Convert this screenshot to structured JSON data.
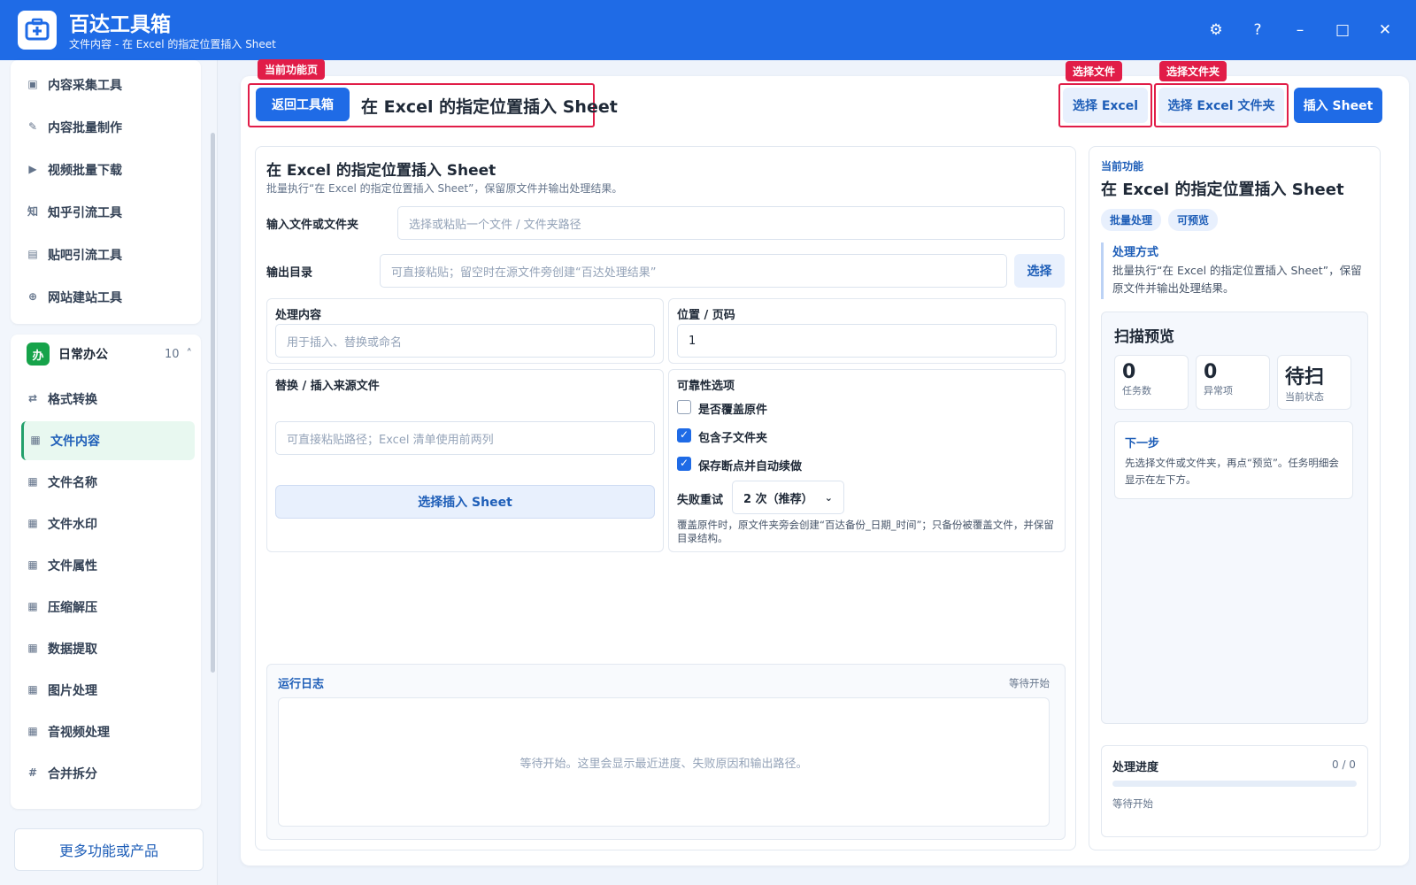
{
  "app": {
    "title": "百达工具箱",
    "subtitle": "文件内容 - 在 Excel 的指定位置插入 Sheet"
  },
  "window_controls": {
    "settings": "⚙",
    "help": "?",
    "minimize": "–",
    "maximize": "□",
    "close": "✕"
  },
  "sidebar": {
    "tools_items": [
      {
        "icon": "▣",
        "label": "内容采集工具"
      },
      {
        "icon": "✎",
        "label": "内容批量制作"
      },
      {
        "icon": "▶",
        "label": "视频批量下载"
      },
      {
        "icon": "知",
        "label": "知乎引流工具"
      },
      {
        "icon": "▤",
        "label": "贴吧引流工具"
      },
      {
        "icon": "⊕",
        "label": "网站建站工具"
      }
    ],
    "group": {
      "badge": "办",
      "name": "日常办公",
      "count": "10",
      "chevron": "˄"
    },
    "office_items": [
      {
        "icon": "⇄",
        "label": "格式转换"
      },
      {
        "icon": "▦",
        "label": "文件内容"
      },
      {
        "icon": "▦",
        "label": "文件名称"
      },
      {
        "icon": "▦",
        "label": "文件水印"
      },
      {
        "icon": "▦",
        "label": "文件属性"
      },
      {
        "icon": "▦",
        "label": "压缩解压"
      },
      {
        "icon": "▦",
        "label": "数据提取"
      },
      {
        "icon": "▦",
        "label": "图片处理"
      },
      {
        "icon": "▦",
        "label": "音视频处理"
      },
      {
        "icon": "#",
        "label": "合并拆分"
      }
    ],
    "active_index": 1,
    "more_label": "更多功能或产品"
  },
  "annotations": {
    "current_page": "当前功能页",
    "select_file": "选择文件",
    "select_folder": "选择文件夹"
  },
  "toolbar": {
    "back_label": "返回工具箱",
    "page_title": "在 Excel 的指定位置插入 Sheet",
    "select_excel": "选择 Excel",
    "select_excel_folder": "选择 Excel 文件夹",
    "insert_sheet": "插入 Sheet"
  },
  "form": {
    "title": "在 Excel 的指定位置插入 Sheet",
    "desc": "批量执行“在 Excel 的指定位置插入 Sheet”，保留原文件并输出处理结果。",
    "input_label": "输入文件或文件夹",
    "input_placeholder": "选择或粘贴一个文件 / 文件夹路径",
    "output_label": "输出目录",
    "output_placeholder": "可直接粘贴；留空时在源文件旁创建“百达处理结果”",
    "choose_label": "选择",
    "content_label": "处理内容",
    "content_placeholder": "用于插入、替换或命名",
    "position_label": "位置 / 页码",
    "position_value": "1",
    "source_label": "替换 / 插入来源文件",
    "source_placeholder": "可直接粘贴路径；Excel 清单使用前两列",
    "choose_sheet": "选择插入 Sheet",
    "reliability_label": "可靠性选项",
    "options": [
      {
        "label": "是否覆盖原件",
        "checked": false
      },
      {
        "label": "包含子文件夹",
        "checked": true
      },
      {
        "label": "保存断点并自动续做",
        "checked": true
      }
    ],
    "retry_label": "失败重试",
    "retry_value": "2 次（推荐）",
    "note": "覆盖原件时，原文件夹旁会创建“百达备份_日期_时间”；只备份被覆盖文件，并保留目录结构。"
  },
  "log": {
    "title": "运行日志",
    "status": "等待开始",
    "empty": "等待开始。这里会显示最近进度、失败原因和输出路径。"
  },
  "right": {
    "current_label": "当前功能",
    "title": "在 Excel 的指定位置插入 Sheet",
    "tags": [
      "批量处理",
      "可预览"
    ],
    "method_title": "处理方式",
    "method_desc": "批量执行“在 Excel 的指定位置插入 Sheet”，保留原文件并输出处理结果。",
    "scan_title": "扫描预览",
    "stats": [
      {
        "value": "0",
        "label": "任务数"
      },
      {
        "value": "0",
        "label": "异常项"
      },
      {
        "value": "待扫",
        "label": "当前状态"
      }
    ],
    "next_title": "下一步",
    "next_desc": "先选择文件或文件夹，再点“预览”。任务明细会显示在左下方。",
    "progress_title": "处理进度",
    "progress_count": "0 / 0",
    "progress_fraction": 0,
    "progress_status": "等待开始"
  }
}
